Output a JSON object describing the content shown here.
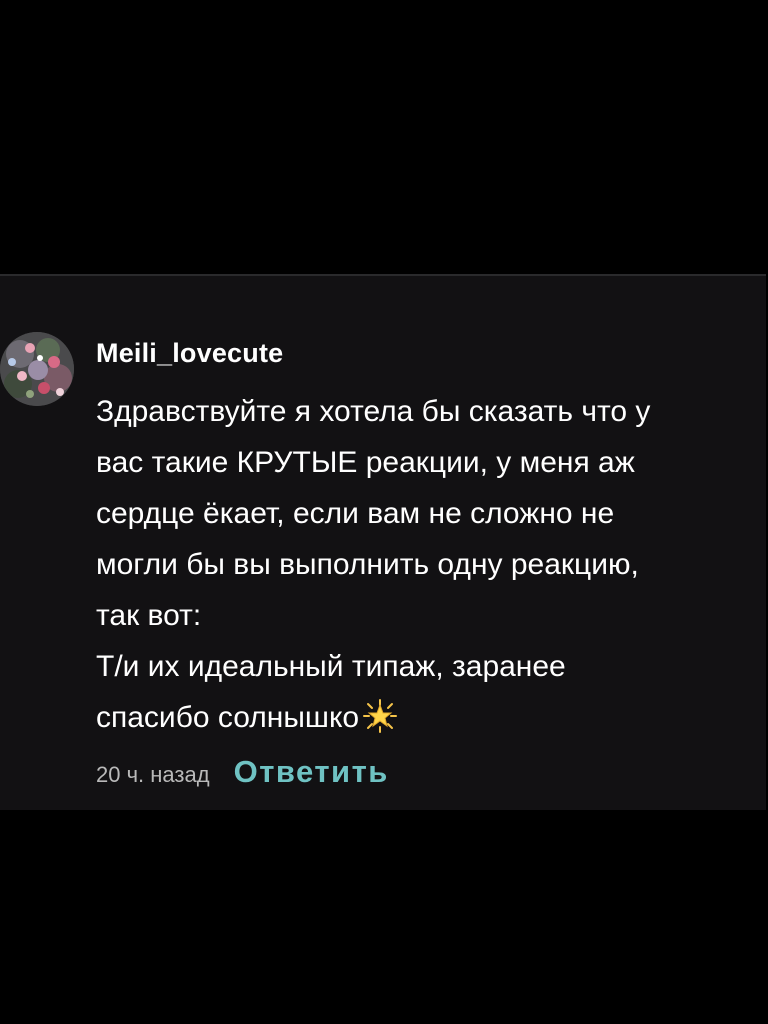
{
  "comment": {
    "username": "Meili_lovecute",
    "text": "Здравствуйте я хотела бы сказать что у\nвас такие КРУТЫЕ реакции, у меня аж\nсердце ёкает, если вам не сложно не\nмогли бы вы выполнить одну реакцию,\nтак вот:\nТ/и их идеальный типаж, заранее\nспасибо солнышко",
    "emoji": "star-icon",
    "timestamp": "20 ч. назад",
    "reply_label": "Ответить"
  },
  "colors": {
    "background": "#000000",
    "card": "#121113",
    "text": "#ffffff",
    "muted": "#b9b9b9",
    "accent": "#6fc2c3"
  }
}
